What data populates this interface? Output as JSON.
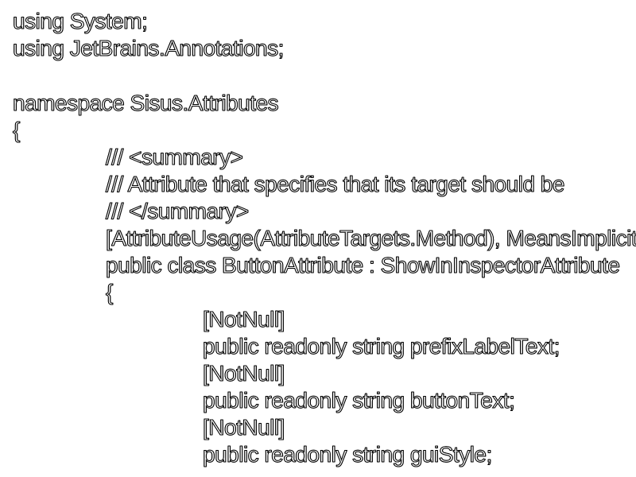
{
  "code": {
    "lines": [
      "using System;",
      "using JetBrains.Annotations;",
      "",
      "namespace Sisus.Attributes",
      "{",
      "/// <summary>",
      "/// Attribute that specifies that its target should be",
      "/// </summary>",
      "[AttributeUsage(AttributeTargets.Method), MeansImplicitUse]",
      "public class ButtonAttribute : ShowInInspectorAttribute",
      "{",
      "[NotNull]",
      "public readonly string prefixLabelText;",
      "[NotNull]",
      "public readonly string buttonText;",
      "[NotNull]",
      "public readonly string guiStyle;"
    ]
  },
  "colors": {
    "background": "#ffffff",
    "text_fill": "#ffffff",
    "text_outline": "#000000"
  }
}
